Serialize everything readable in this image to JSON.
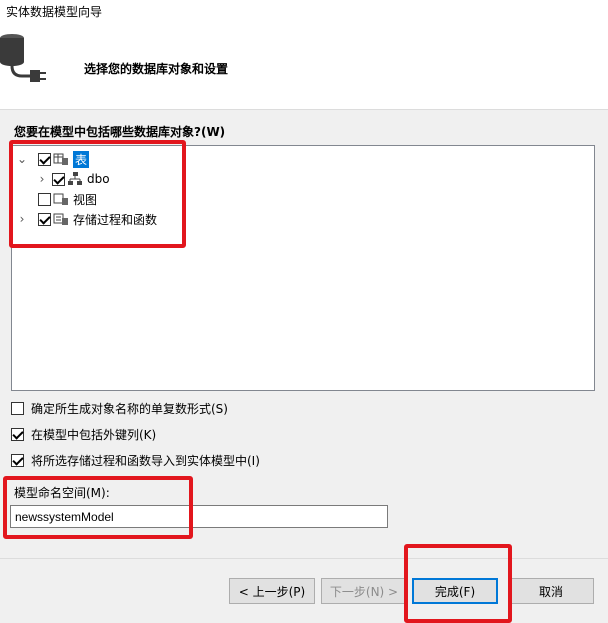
{
  "window": {
    "title": "实体数据模型向导"
  },
  "header": {
    "subtitle": "选择您的数据库对象和设置"
  },
  "objects": {
    "label": "您要在模型中包括哪些数据库对象?(W)",
    "tree": [
      {
        "label": "表",
        "checked": true,
        "expanded": true,
        "selected": true
      },
      {
        "label": "dbo",
        "checked": true,
        "expanded": false
      },
      {
        "label": "视图",
        "checked": false
      },
      {
        "label": "存储过程和函数",
        "checked": true,
        "expanded": false
      }
    ]
  },
  "options": [
    {
      "label": "确定所生成对象名称的单复数形式(S)",
      "checked": false
    },
    {
      "label": "在模型中包括外键列(K)",
      "checked": true
    },
    {
      "label": "将所选存储过程和函数导入到实体模型中(I)",
      "checked": true
    }
  ],
  "namespace": {
    "label": "模型命名空间(M):",
    "value": "newssystemModel"
  },
  "buttons": {
    "prev": "< 上一步(P)",
    "next": "下一步(N) >",
    "finish": "完成(F)",
    "cancel": "取消"
  },
  "colors": {
    "selection": "#0078d7",
    "highlight": "#e2161d"
  }
}
